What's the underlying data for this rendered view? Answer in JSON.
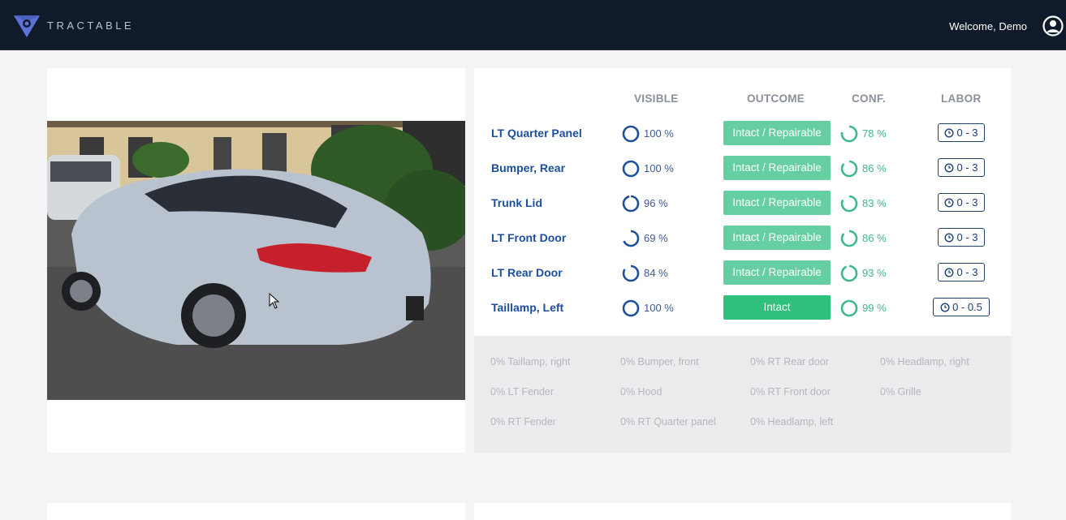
{
  "header": {
    "brand": "TRACTABLE",
    "welcome": "Welcome, Demo",
    "logo_icon": "tractable-logo-icon",
    "user_icon": "user-account-icon"
  },
  "colors": {
    "topbar": "#0f1b2b",
    "part_name": "#1d4e9c",
    "outcome_repairable": "#66cfa2",
    "outcome_intact": "#2fc07c",
    "confidence": "#3fb889",
    "labor_border": "#1d3f72"
  },
  "photo": {
    "description_icon": "car-photo"
  },
  "table": {
    "headers": {
      "visible": "VISIBLE",
      "outcome": "OUTCOME",
      "conf": "CONF.",
      "labor": "LABOR"
    },
    "rows": [
      {
        "part": "LT Quarter Panel",
        "visible": "100 %",
        "visible_pct": 100,
        "outcome": "Intact / Repairable",
        "conf": "78 %",
        "conf_pct": 78,
        "labor": "0 - 3"
      },
      {
        "part": "Bumper, Rear",
        "visible": "100 %",
        "visible_pct": 100,
        "outcome": "Intact / Repairable",
        "conf": "86 %",
        "conf_pct": 86,
        "labor": "0 - 3"
      },
      {
        "part": "Trunk Lid",
        "visible": "96 %",
        "visible_pct": 96,
        "outcome": "Intact / Repairable",
        "conf": "83 %",
        "conf_pct": 83,
        "labor": "0 - 3"
      },
      {
        "part": "LT Front Door",
        "visible": "69 %",
        "visible_pct": 69,
        "outcome": "Intact / Repairable",
        "conf": "86 %",
        "conf_pct": 86,
        "labor": "0 - 3"
      },
      {
        "part": "LT Rear Door",
        "visible": "84 %",
        "visible_pct": 84,
        "outcome": "Intact / Repairable",
        "conf": "93 %",
        "conf_pct": 93,
        "labor": "0 - 3"
      },
      {
        "part": "Taillamp, Left",
        "visible": "100 %",
        "visible_pct": 100,
        "outcome": "Intact",
        "conf": "99 %",
        "conf_pct": 99,
        "labor": "0 - 0.5"
      }
    ]
  },
  "not_visible": [
    "0% Taillamp, right",
    "0% Bumper, front",
    "0% RT Rear door",
    "0% Headlamp, right",
    "0% LT Fender",
    "0% Hood",
    "0% RT Front door",
    "0% Grille",
    "0% RT Fender",
    "0% RT Quarter panel",
    "0% Headlamp, left"
  ]
}
